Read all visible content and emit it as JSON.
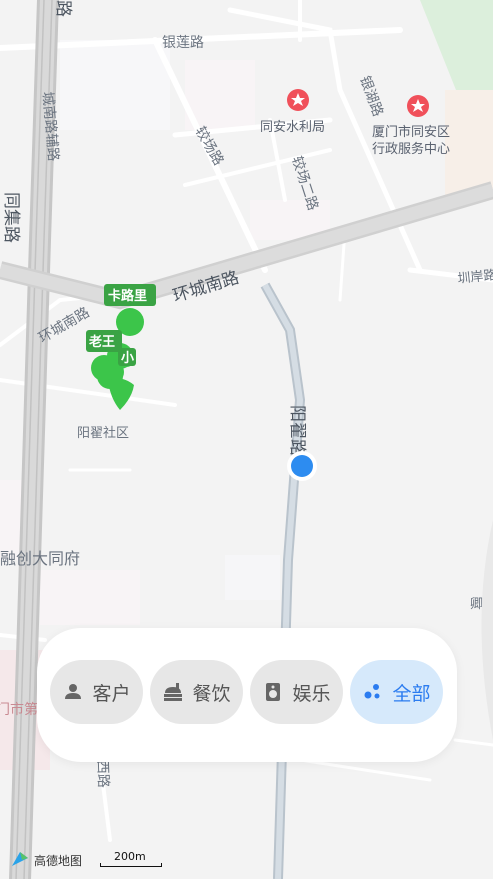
{
  "map": {
    "roads": {
      "huancheng_nan_road": "环城南路",
      "huancheng_nan_road_2": "环城南路",
      "yinlian_road": "银莲路",
      "yinhu_road": "银湖路",
      "jiaochang_road": "较场路",
      "jiaochang_2nd_road": "较场二路",
      "chengnan_aux_road": "城南路辅路",
      "tongji_road": "同集路",
      "yangdi_road": "阳翟路",
      "xi_road": "西路",
      "lu_top": "路",
      "zhenan_road": "圳岸路"
    },
    "areas": {
      "yangdi_community": "阳翟社区",
      "rongchuang": "融创大同府",
      "qingpu": "卿朴",
      "city_cut": "门市第"
    },
    "pois": [
      {
        "name": "同安水利局"
      },
      {
        "name_line1": "厦门市同安区",
        "name_line2": "行政服务中心"
      }
    ],
    "markers": [
      {
        "label": "卡路里"
      },
      {
        "label": "老王"
      },
      {
        "label": "小"
      }
    ]
  },
  "filter_bar": {
    "chips": [
      {
        "label": "客户",
        "icon": "person-icon"
      },
      {
        "label": "餐饮",
        "icon": "dining-icon"
      },
      {
        "label": "娱乐",
        "icon": "speaker-icon"
      },
      {
        "label": "全部",
        "icon": "dots-icon",
        "active": true
      }
    ]
  },
  "footer": {
    "logo_text": "高德地图",
    "scale": "200m"
  },
  "colors": {
    "marker_green": "#3cc54a",
    "location_blue": "#2d8cf0",
    "active_chip_bg": "#d6e9fb",
    "active_chip_text": "#2b7cf0",
    "poi_red": "#f0505a"
  }
}
